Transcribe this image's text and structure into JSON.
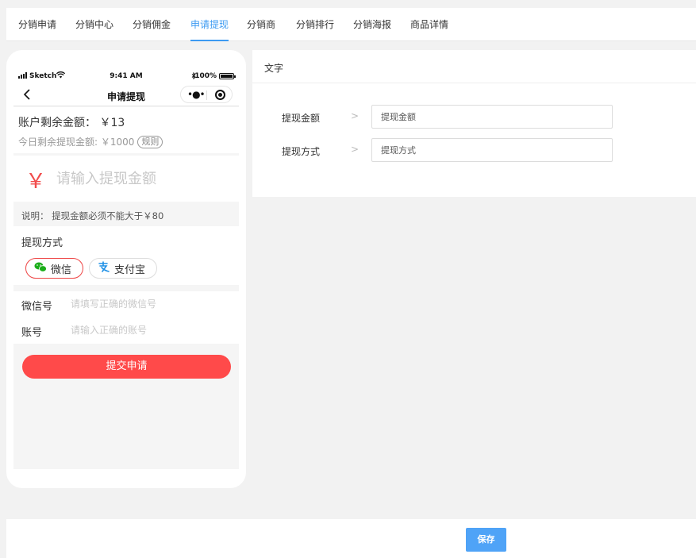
{
  "tabs": [
    {
      "label": "分销申请"
    },
    {
      "label": "分销中心"
    },
    {
      "label": "分销佣金"
    },
    {
      "label": "申请提现",
      "active": true
    },
    {
      "label": "分销商"
    },
    {
      "label": "分销排行"
    },
    {
      "label": "分销海报"
    },
    {
      "label": "商品详情"
    }
  ],
  "phone": {
    "status_bar": {
      "carrier": "Sketch",
      "time": "9:41 AM",
      "battery": "100%"
    },
    "nav_title": "申请提现",
    "balance_line": "账户剩余金额： ￥13",
    "today_line": "今日剩余提现金额: ￥1000",
    "rules_label": "规则",
    "currency_symbol": "￥",
    "amount_placeholder": "请输入提现金额",
    "note": "说明： 提现金额必须不能大于￥80",
    "method_label": "提现方式",
    "methods": [
      {
        "label": "微信",
        "icon": "wechat-icon",
        "selected": true
      },
      {
        "label": "支付宝",
        "icon": "alipay-icon",
        "selected": false
      }
    ],
    "fields": [
      {
        "label": "微信号",
        "placeholder": "请填写正确的微信号"
      },
      {
        "label": "账号",
        "placeholder": "请输入正确的账号"
      }
    ],
    "submit_label": "提交申请"
  },
  "panel": {
    "heading": "文字",
    "rows": [
      {
        "label": "提现金额",
        "placeholder": "提现金额"
      },
      {
        "label": "提现方式",
        "placeholder": "提现方式"
      }
    ]
  },
  "footer": {
    "save_label": "保存"
  },
  "colors": {
    "accent": "#3d9bf2",
    "brand_red": "#ff4a4a",
    "save_blue": "#4fa3f7"
  }
}
